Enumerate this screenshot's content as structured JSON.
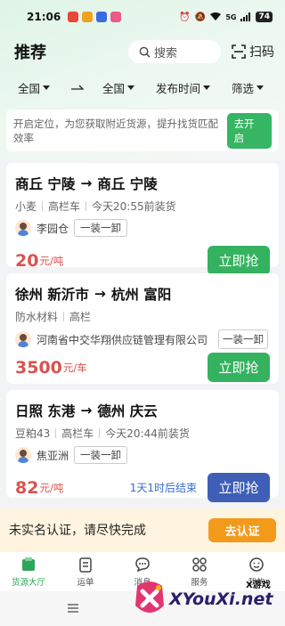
{
  "status_bar": {
    "time": "21:06",
    "battery": "74",
    "network": "5G"
  },
  "header": {
    "title": "推荐",
    "search_label": "搜索",
    "scan_label": "扫码"
  },
  "filters": {
    "from": "全国",
    "to": "全国",
    "time": "发布时间",
    "filter": "筛选"
  },
  "location_banner": {
    "text": "开启定位，为您获取附近货源，提升找货匹配效率",
    "button": "去开启"
  },
  "cards": [
    {
      "from": "商丘 宁陵",
      "to": "商丘 宁陵",
      "meta": [
        "小麦",
        "高栏车",
        "今天20:55前装货"
      ],
      "person": "李园仓",
      "tag": "一装一卸",
      "price": "20",
      "unit": "元/吨",
      "button": "立即抢",
      "countdown": ""
    },
    {
      "from": "徐州 新沂市",
      "to": "杭州 富阳",
      "meta": [
        "防水材料",
        "高栏"
      ],
      "person": "河南省中交华翔供应链管理有限公司",
      "tag": "一装一卸",
      "price": "3500",
      "unit": "元/车",
      "button": "立即抢",
      "countdown": ""
    },
    {
      "from": "日照 东港",
      "to": "德州 庆云",
      "meta": [
        "豆粕43",
        "高栏车",
        "今天20:44前装货"
      ],
      "person": "焦亚洲",
      "tag": "一装一卸",
      "price": "82",
      "unit": "元/吨",
      "button": "立即抢",
      "countdown": "1天1时后结束"
    }
  ],
  "verify_bar": {
    "text": "未实名认证，请尽快完成",
    "button": "去认证"
  },
  "tabs": [
    {
      "label": "货源大厅",
      "icon": "cargo-hall-icon",
      "active": true
    },
    {
      "label": "运单",
      "icon": "waybill-icon",
      "active": false
    },
    {
      "label": "消息",
      "icon": "message-icon",
      "active": false
    },
    {
      "label": "服务",
      "icon": "service-icon",
      "active": false
    },
    {
      "label": "我的",
      "icon": "profile-icon",
      "active": false
    }
  ],
  "watermark": {
    "small": "X游戏",
    "big": "XYouXi.net"
  },
  "colors": {
    "primary_green": "#35b25f",
    "price_red": "#d9534f",
    "accent_blue": "#3f5fb7",
    "orange": "#f39a1b"
  }
}
